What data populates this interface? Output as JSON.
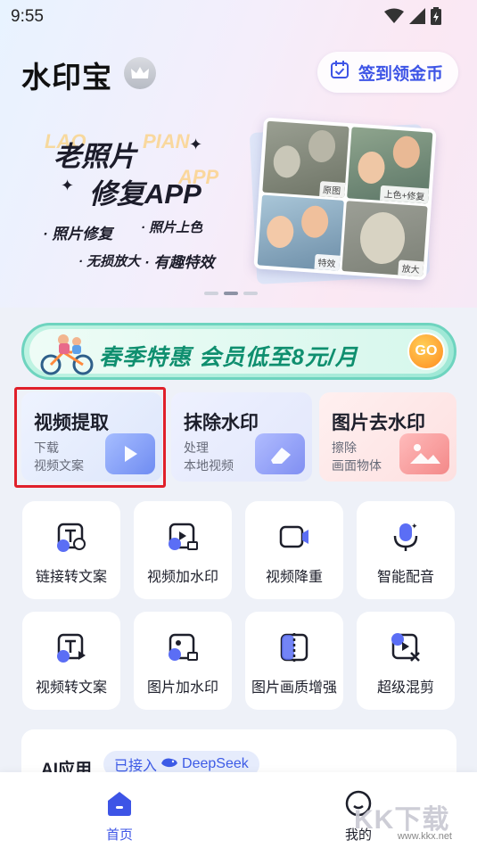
{
  "status_bar": {
    "time": "9:55"
  },
  "header": {
    "app_title": "水印宝",
    "checkin_label": "签到领金币"
  },
  "banner": {
    "title_line1": "老照片",
    "title_line2": "修复APP",
    "ghost_text1": "LAO",
    "ghost_text2": "PIAN",
    "ghost_text3": "APP",
    "features": [
      "· 照片修复",
      "· 照片上色",
      "· 无损放大",
      "· 有趣特效"
    ],
    "photo_tags": [
      "原图",
      "上色+修复",
      "特效",
      "放大"
    ],
    "page_count": 3,
    "active_page": 2
  },
  "promo": {
    "text": "春季特惠 会员低至8元/月",
    "go_label": "GO"
  },
  "feature_cards": [
    {
      "title": "视频提取",
      "sub1": "下载",
      "sub2": "视频文案"
    },
    {
      "title": "抹除水印",
      "sub1": "处理",
      "sub2": "本地视频"
    },
    {
      "title": "图片去水印",
      "sub1": "擦除",
      "sub2": "画面物体"
    }
  ],
  "tools": [
    {
      "label": "链接转文案",
      "icon": "link-to-text-icon"
    },
    {
      "label": "视频加水印",
      "icon": "video-watermark-icon"
    },
    {
      "label": "视频降重",
      "icon": "video-dedupe-icon"
    },
    {
      "label": "智能配音",
      "icon": "microphone-icon"
    },
    {
      "label": "视频转文案",
      "icon": "video-to-text-icon"
    },
    {
      "label": "图片加水印",
      "icon": "image-watermark-icon"
    },
    {
      "label": "图片画质增强",
      "icon": "image-enhance-icon"
    },
    {
      "label": "超级混剪",
      "icon": "super-mix-icon"
    }
  ],
  "ai_section": {
    "title": "AI应用",
    "chip_prefix": "已接入",
    "chip_brand": "DeepSeek"
  },
  "bottom_nav": {
    "home_label": "首页",
    "mine_label": "我的"
  },
  "watermark": {
    "text": "KK下载",
    "url": "www.kkx.net"
  },
  "colors": {
    "accent": "#3d54e6",
    "promo_green": "#0f8f6f",
    "selection_red": "#e0202a"
  }
}
